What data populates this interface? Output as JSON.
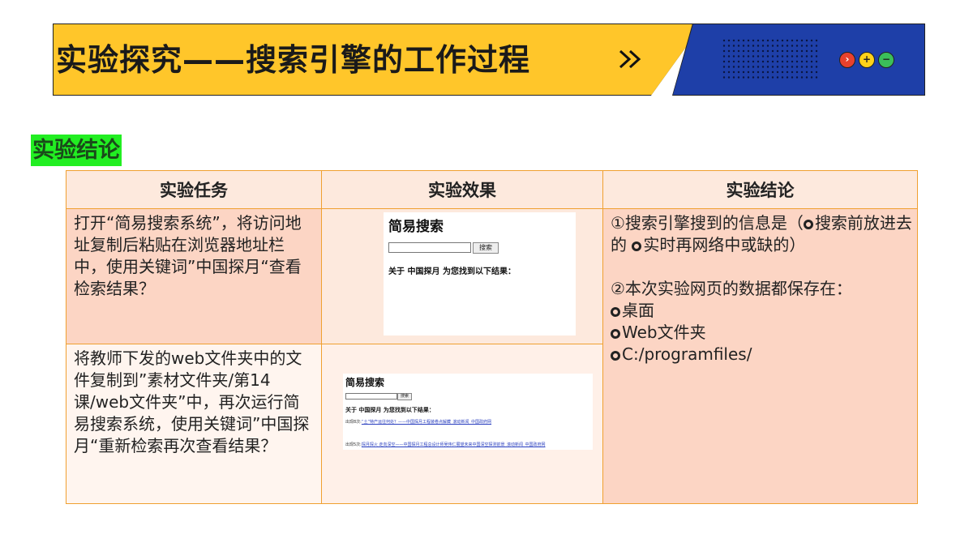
{
  "banner": {
    "title": "实验探究——搜索引擎的工作过程"
  },
  "colors": {
    "banner_yellow": "#ffc62a",
    "banner_blue": "#1e3fa8",
    "tag_green": "#22ee22",
    "table_border": "#f0a030"
  },
  "icons": {
    "forward": "double-chevron-icon",
    "controls": [
      "close-icon",
      "plus-icon",
      "minus-icon"
    ]
  },
  "section_tag": "实验结论",
  "table": {
    "headers": [
      "实验任务",
      "实验效果",
      "实验结论"
    ],
    "rows": [
      {
        "task": "打开“简易搜索系统”，将访问地址复制后粘贴在浏览器地址栏中，使用关键词”中国探月“查看检索结果？"
      },
      {
        "task": "将教师下发的web文件夹中的文件复制到”素材文件夹/第14课/web文件夹”中，再次运行简易搜索系统，使用关键词”中国探月“重新检索再次查看结果？"
      }
    ],
    "conclusion": {
      "q1_prefix": "①搜索引擎搜到的信息是（",
      "q1_opt1": "搜索前放进去的",
      "q1_opt2": "实时再网络中或缺的）",
      "q2": "②本次实验网页的数据都保存在：",
      "options": [
        "桌面",
        "Web文件夹",
        "C:/programfiles/"
      ]
    }
  },
  "screenshot1": {
    "title": "简易搜索",
    "button": "搜索",
    "result": "关于 中国探月 为您找到以下结果："
  },
  "screenshot2": {
    "title": "简易搜索",
    "button": "搜索",
    "result": "关于 中国探月 为您找到以下结果：",
    "line1_prefix": "出现8次:",
    "line1_link": "“土”特产运往何处？——中国探月工程装卷点解藏_滚动新闻_中国政府网",
    "line2_prefix": "出现5次:",
    "line2_link": "探月探火 走向深空——中国探月工程总设计师吴伟仁展望未来中国深空探测前景_滚动新闻_中国政府网"
  }
}
